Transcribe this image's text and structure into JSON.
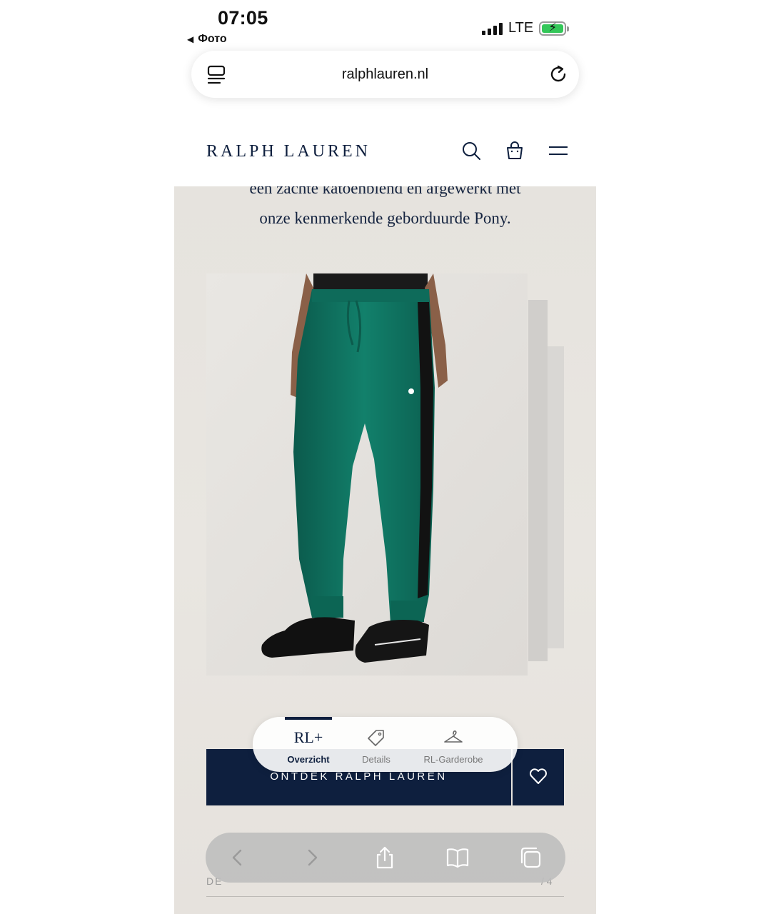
{
  "status_bar": {
    "time": "07:05",
    "back_label": "Фото",
    "network": "LTE",
    "signal_level": 4,
    "battery_level": 1.0,
    "charging": true
  },
  "browser": {
    "url": "ralphlauren.nl",
    "icons": {
      "tabs": "tab-overview-icon",
      "reload": "reload-icon"
    }
  },
  "header": {
    "logo": "RALPH LAUREN",
    "icons": [
      "search-icon",
      "bag-icon",
      "menu-icon"
    ]
  },
  "product": {
    "description_line1": "een zachte katoenblend en afgewerkt met",
    "description_line2": "onze kenmerkende geborduurde Pony.",
    "image_alt": "green sweatpants with black side stripe"
  },
  "cta": {
    "label": "ONTDEK RALPH LAUREN",
    "favorite_icon": "heart-icon"
  },
  "product_tabs": {
    "active_index": 0,
    "items": [
      {
        "icon": "RL+",
        "label": "Overzicht"
      },
      {
        "icon": "tag-icon",
        "label": "Details"
      },
      {
        "icon": "hanger-icon",
        "label": "RL-Garderobe"
      }
    ]
  },
  "toolbar": {
    "icons": [
      "back-icon",
      "forward-icon",
      "share-icon",
      "bookmarks-icon",
      "tabs-icon"
    ]
  },
  "below": {
    "left_text": "DE",
    "right_text": "/ 4"
  },
  "colors": {
    "brand_navy": "#0e1f3e",
    "panel_bg": "#e8e5e0",
    "pants_green": "#0f6e5c",
    "battery_green": "#34c759"
  }
}
